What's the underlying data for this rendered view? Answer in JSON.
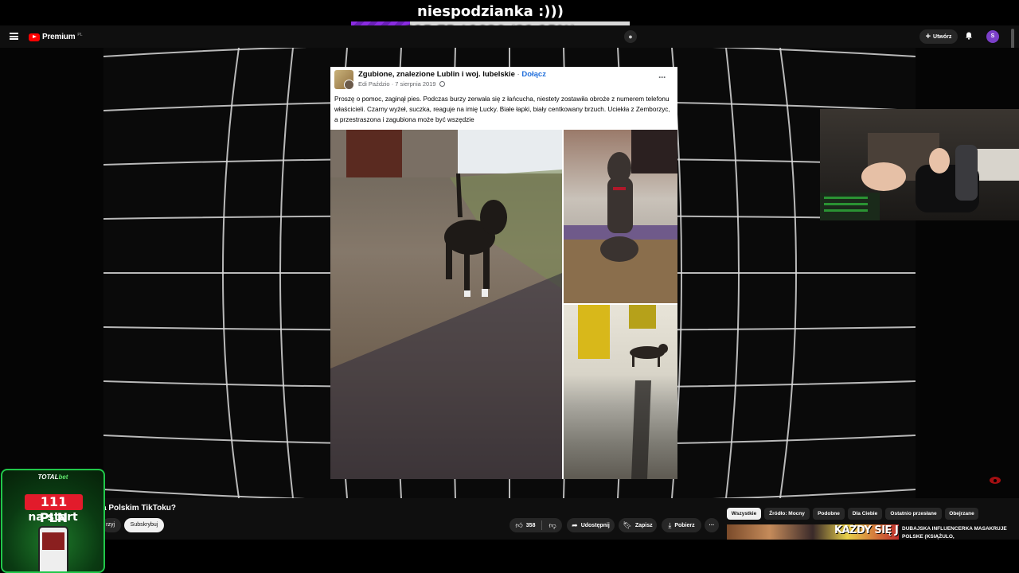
{
  "overlay": {
    "title": "niespodzianka :)))",
    "progress_text": "215.75 / 1020 (21.15%)",
    "progress_fraction": 0.2115
  },
  "header": {
    "logo_text": "Premium",
    "logo_region": "PL",
    "create_label": "Utwórz",
    "avatar_letter": "S"
  },
  "post": {
    "group_name": "Zgubione, znalezione Lublin i woj. lubelskie",
    "separator": " · ",
    "join_label": "Dołącz",
    "author": "Edi Paździo",
    "date": "7 sierpnia 2019",
    "meta_sep": " · ",
    "more_label": "···",
    "text": "Proszę o pomoc, zaginął pies. Podczas burzy zerwała się z łańcucha, niestety zostawiła obroże z numerem telefonu właścicieli. Czarny wyżeł, suczka, reaguje na imię Lucky. Białe łapki, biały centkowany brzuch. Uciekła z Zemborzyc, a przestraszona i zagubiona może być wszędzie"
  },
  "video": {
    "title": "a Polskim TikToku?",
    "join_label": "rzyj",
    "subscribe_label": "Subskrybuj",
    "like_count": "358",
    "share_label": "Udostępnij",
    "save_label": "Zapisz",
    "download_label": "Pobierz",
    "more_label": "···"
  },
  "chips": [
    {
      "label": "Wszystkie",
      "active": true
    },
    {
      "label": "Źródło: Mocny",
      "active": false
    },
    {
      "label": "Podobne",
      "active": false
    },
    {
      "label": "Dla Ciebie",
      "active": false
    },
    {
      "label": "Ostatnio przesłane",
      "active": false
    },
    {
      "label": "Obejrzane",
      "active": false
    }
  ],
  "recommendation": {
    "thumb_text": "KAŻDY SIĘ JEJ WYRZEKA",
    "title": "DUBAJSKA INFLUENCERKA MASAKRUJE POLSKE (KSIĄŻULO,"
  },
  "ad": {
    "brand_a": "TOTAL",
    "brand_b": "bet",
    "amount": "111 PLN",
    "subtitle": "na start"
  },
  "colors": {
    "accent_purple": "#8a2be2",
    "youtube_red": "#ff0000",
    "fb_link": "#216fdb",
    "ad_green": "#21c74a",
    "ad_red": "#e21b2b"
  }
}
